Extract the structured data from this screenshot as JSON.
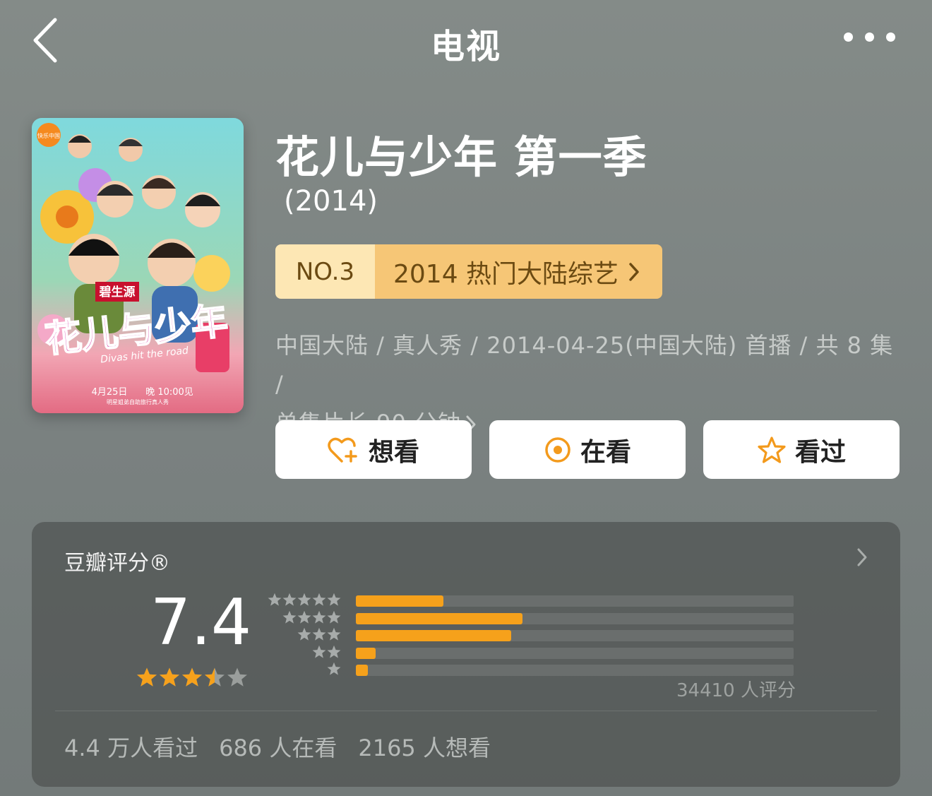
{
  "nav": {
    "back_icon": "chevron-left-icon",
    "title": "电视",
    "more_icon": "more-dots-icon"
  },
  "poster": {
    "logo_text": "快乐中国",
    "brand_text": "碧生源",
    "show_logo_text": "花儿与少年",
    "english_tagline": "Divas hit the road",
    "date_text": "4月25日",
    "time_text": "晚 10:00见",
    "sub_text": "明星姐弟自助旅行真人秀"
  },
  "show": {
    "title": "花儿与少年 第一季",
    "year": "(2014)"
  },
  "rank": {
    "number": "NO.3",
    "category": "2014 热门大陆综艺",
    "accent_light": "#fde7b4",
    "accent": "#f6c676"
  },
  "meta": {
    "line1": "中国大陆 / 真人秀 / 2014-04-25(中国大陆) 首播 / 共 8 集 /",
    "line2": "单集片长 90 分钟"
  },
  "actions": [
    {
      "label": "想看",
      "icon": "heart-plus-icon"
    },
    {
      "label": "在看",
      "icon": "target-circle-icon"
    },
    {
      "label": "看过",
      "icon": "star-outline-icon"
    }
  ],
  "rating": {
    "title": "豆瓣评分®",
    "score": "7.4",
    "stars": 3.5,
    "distribution": [
      {
        "stars": 5,
        "fraction": 0.2
      },
      {
        "stars": 4,
        "fraction": 0.38
      },
      {
        "stars": 3,
        "fraction": 0.355
      },
      {
        "stars": 2,
        "fraction": 0.045
      },
      {
        "stars": 1,
        "fraction": 0.028
      }
    ],
    "count_text": "34410 人评分",
    "watched": "4.4 万人看过",
    "watching": "686 人在看",
    "want": "2165 人想看",
    "accent": "#f6a11b"
  }
}
